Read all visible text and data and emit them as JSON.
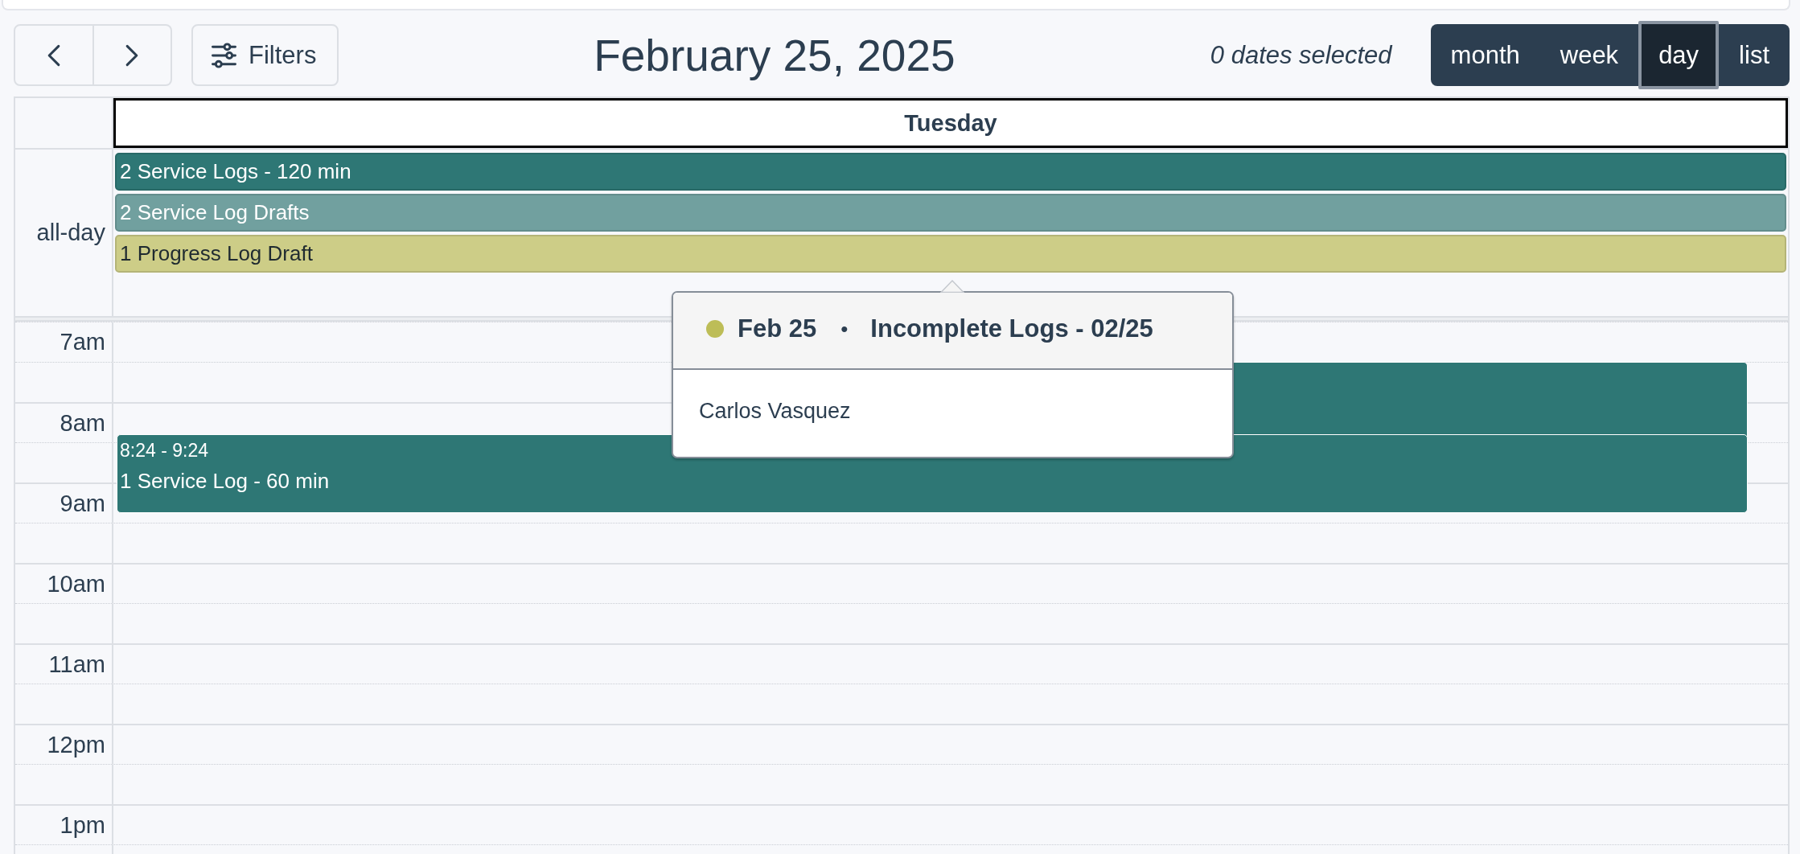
{
  "toolbar": {
    "filter_button": "Filters",
    "title": "February 25, 2025",
    "selection_status": "0 dates selected",
    "views": [
      {
        "label": "month",
        "selected": false
      },
      {
        "label": "week",
        "selected": false
      },
      {
        "label": "day",
        "selected": true
      },
      {
        "label": "list",
        "selected": false
      }
    ]
  },
  "calendar": {
    "day_header": "Tuesday",
    "all_day_label": "all-day",
    "all_day_events": [
      {
        "title": "2 Service Logs - 120 min",
        "color": "#2e7775"
      },
      {
        "title": "2 Service Log Drafts",
        "color": "#71a09f"
      },
      {
        "title": "1 Progress Log Draft",
        "color": "#cdcd87"
      }
    ],
    "time_slots": [
      "7am",
      "8am",
      "9am",
      "10am",
      "11am",
      "12pm",
      "1pm"
    ],
    "timed_events": [
      {
        "kind": "covered"
      },
      {
        "kind": "event",
        "time": "8:24 - 9:24",
        "title": "1 Service Log - 60 min"
      }
    ]
  },
  "popover": {
    "color": "#bdbd57",
    "date": "Feb 25",
    "separator": "•",
    "title": "Incomplete Logs - 02/25",
    "person": "Carlos Vasquez"
  }
}
